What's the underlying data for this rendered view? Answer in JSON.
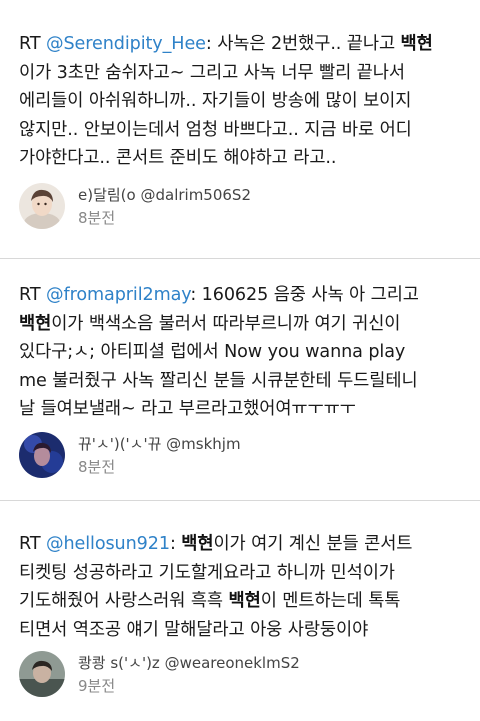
{
  "tweets": [
    {
      "lines": [
        [
          {
            "t": "RT "
          },
          {
            "t": "@Serendipity_Hee",
            "k": "mention"
          },
          {
            "t": ": 사녹은 2번했구.. 끝나고 "
          },
          {
            "t": "백현",
            "k": "strong"
          }
        ],
        [
          {
            "t": "이가 3초만 숨쉬자고~ 그리고 사녹 너무 빨리 끝나서"
          }
        ],
        [
          {
            "t": "에리들이 아쉬워하니까.. 자기들이 방송에 많이 보이지"
          }
        ],
        [
          {
            "t": "않지만.. 안보이는데서 엄청 바쁘다고.. 지금 바로 어디"
          }
        ],
        [
          {
            "t": "가야한다고.. 콘서트 준비도 해야하고 라고.."
          }
        ]
      ],
      "author": "e)달림(o @dalrim506S2",
      "time": "8분전"
    },
    {
      "lines": [
        [
          {
            "t": "RT "
          },
          {
            "t": "@fromapril2may",
            "k": "mention"
          },
          {
            "t": ": 160625 음중 사녹 아 그리고"
          }
        ],
        [
          {
            "t": "백현",
            "k": "strong"
          },
          {
            "t": "이가 백색소음 불러서 따라부르니까 여기 귀신이"
          }
        ],
        [
          {
            "t": "있다구;ㅅ; 아티피셜 럽에서 Now you wanna play"
          }
        ],
        [
          {
            "t": "me 불러줬구 사녹 짤리신 분들 시큐분한테 두드릴테니"
          }
        ],
        [
          {
            "t": "날 들여보낼래~ 라고 부르라고했어여ㅠㅜㅠㅜ"
          }
        ]
      ],
      "author": "뀨'ㅅ')('ㅅ'뀨 @mskhjm",
      "time": "8분전"
    },
    {
      "lines": [
        [
          {
            "t": "RT "
          },
          {
            "t": "@hellosun921",
            "k": "mention"
          },
          {
            "t": ": "
          },
          {
            "t": "백현",
            "k": "strong"
          },
          {
            "t": "이가 여기 계신 분들 콘서트"
          }
        ],
        [
          {
            "t": "티켓팅 성공하라고 기도할게요라고 하니까 민석이가"
          }
        ],
        [
          {
            "t": "기도해줬어 사랑스러워 흑흑 "
          },
          {
            "t": "백현",
            "k": "strong"
          },
          {
            "t": "이 멘트하는데 톡톡"
          }
        ],
        [
          {
            "t": "티면서 역조공 얘기 말해달라고 아웅 사랑둥이야"
          }
        ]
      ],
      "author": "쾅쾅 s('ㅅ')z @weareoneklmS2",
      "time": "9분전"
    }
  ],
  "colors": {
    "mention": "#2f82c8",
    "divider": "#d8d8d8",
    "meta": "#888888"
  }
}
